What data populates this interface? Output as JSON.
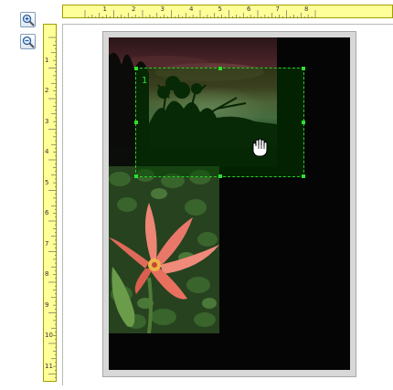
{
  "toolbar": {
    "zoom_in_icon": "zoom-in-icon",
    "zoom_out_icon": "zoom-out-icon"
  },
  "ruler": {
    "top_labels": [
      "1",
      "2",
      "3",
      "4",
      "5",
      "6",
      "7",
      "8"
    ],
    "left_labels": [
      "1",
      "2",
      "3",
      "4",
      "5",
      "6",
      "7",
      "8",
      "9",
      "10",
      "11"
    ],
    "color": "#ffff99"
  },
  "layout_page": {
    "photo_slot_number": "1",
    "slot_border_color": "#28d028"
  },
  "cursor": {
    "icon": "hand-grab-icon"
  }
}
